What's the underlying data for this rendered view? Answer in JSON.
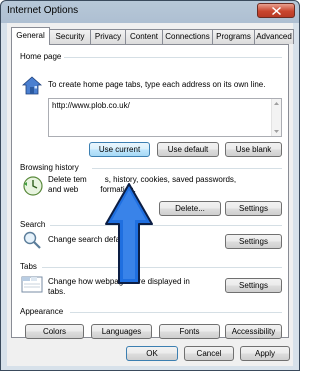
{
  "window": {
    "title": "Internet Options"
  },
  "tabs": [
    {
      "label": "General"
    },
    {
      "label": "Security"
    },
    {
      "label": "Privacy"
    },
    {
      "label": "Content"
    },
    {
      "label": "Connections"
    },
    {
      "label": "Programs"
    },
    {
      "label": "Advanced"
    }
  ],
  "home_page": {
    "heading": "Home page",
    "description": "To create home page tabs, type each address on its own line.",
    "url": "http://www.plob.co.uk/",
    "buttons": {
      "use_current": "Use current",
      "use_default": "Use default",
      "use_blank": "Use blank"
    }
  },
  "browsing_history": {
    "heading": "Browsing history",
    "line1": "Delete tem",
    "line1_rest": "s, history, cookies, saved passwords,",
    "line2": "and web",
    "line2_rest": "formation.",
    "buttons": {
      "delete": "Delete...",
      "settings": "Settings"
    }
  },
  "search": {
    "heading": "Search",
    "description": "Change search defaults.",
    "settings": "Settings"
  },
  "tabs_section": {
    "heading": "Tabs",
    "line1": "Change how webpages are displayed in",
    "line2": "tabs.",
    "settings": "Settings"
  },
  "appearance": {
    "heading": "Appearance",
    "buttons": {
      "colors": "Colors",
      "languages": "Languages",
      "fonts": "Fonts",
      "accessibility": "Accessibility"
    }
  },
  "dialog_buttons": {
    "ok": "OK",
    "cancel": "Cancel",
    "apply": "Apply"
  },
  "colors": {
    "arrow_fill": "#1f6fe0",
    "focus_border": "#3c7fb1"
  }
}
